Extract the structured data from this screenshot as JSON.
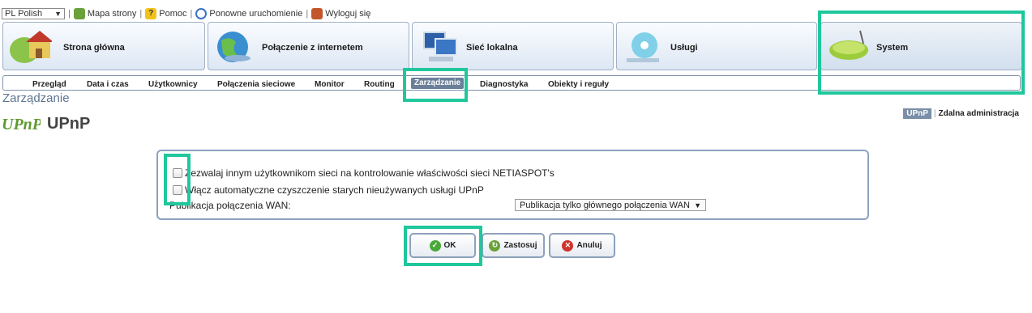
{
  "topbar": {
    "language": "PL Polish",
    "sitemap": "Mapa strony",
    "help": "Pomoc",
    "restart": "Ponowne uruchomienie",
    "logout": "Wyloguj się"
  },
  "main_tabs": [
    {
      "label": "Strona główna",
      "icon": "house-icon"
    },
    {
      "label": "Połączenie z internetem",
      "icon": "globe-icon"
    },
    {
      "label": "Sieć lokalna",
      "icon": "computers-icon"
    },
    {
      "label": "Usługi",
      "icon": "disc-icon"
    },
    {
      "label": "System",
      "icon": "router-icon"
    }
  ],
  "sub_tabs": [
    "Przegląd",
    "Data i czas",
    "Użytkownicy",
    "Połączenia sieciowe",
    "Monitor",
    "Routing",
    "Zarządzanie",
    "Diagnostyka",
    "Obiekty i reguły"
  ],
  "page_title": "Zarządzanie",
  "section_title": "UPnP",
  "right_links": {
    "active": "UPnP",
    "other": "Zdalna administracja"
  },
  "settings": {
    "allow_control": "Zezwalaj innym użytkownikom sieci na kontrolowanie właściwości sieci NETIASPOT's",
    "auto_cleanup": "Włącz automatyczne czyszczenie starych nieużywanych usługi UPnP",
    "wan_publish_label": "Publikacja połączenia WAN:",
    "wan_publish_value": "Publikacja tylko głównego połączenia WAN"
  },
  "buttons": {
    "ok": "OK",
    "apply": "Zastosuj",
    "cancel": "Anuluj"
  },
  "colors": {
    "highlight": "#1fc79c",
    "active_tab": "#6b7f99",
    "title": "#5d7590"
  }
}
